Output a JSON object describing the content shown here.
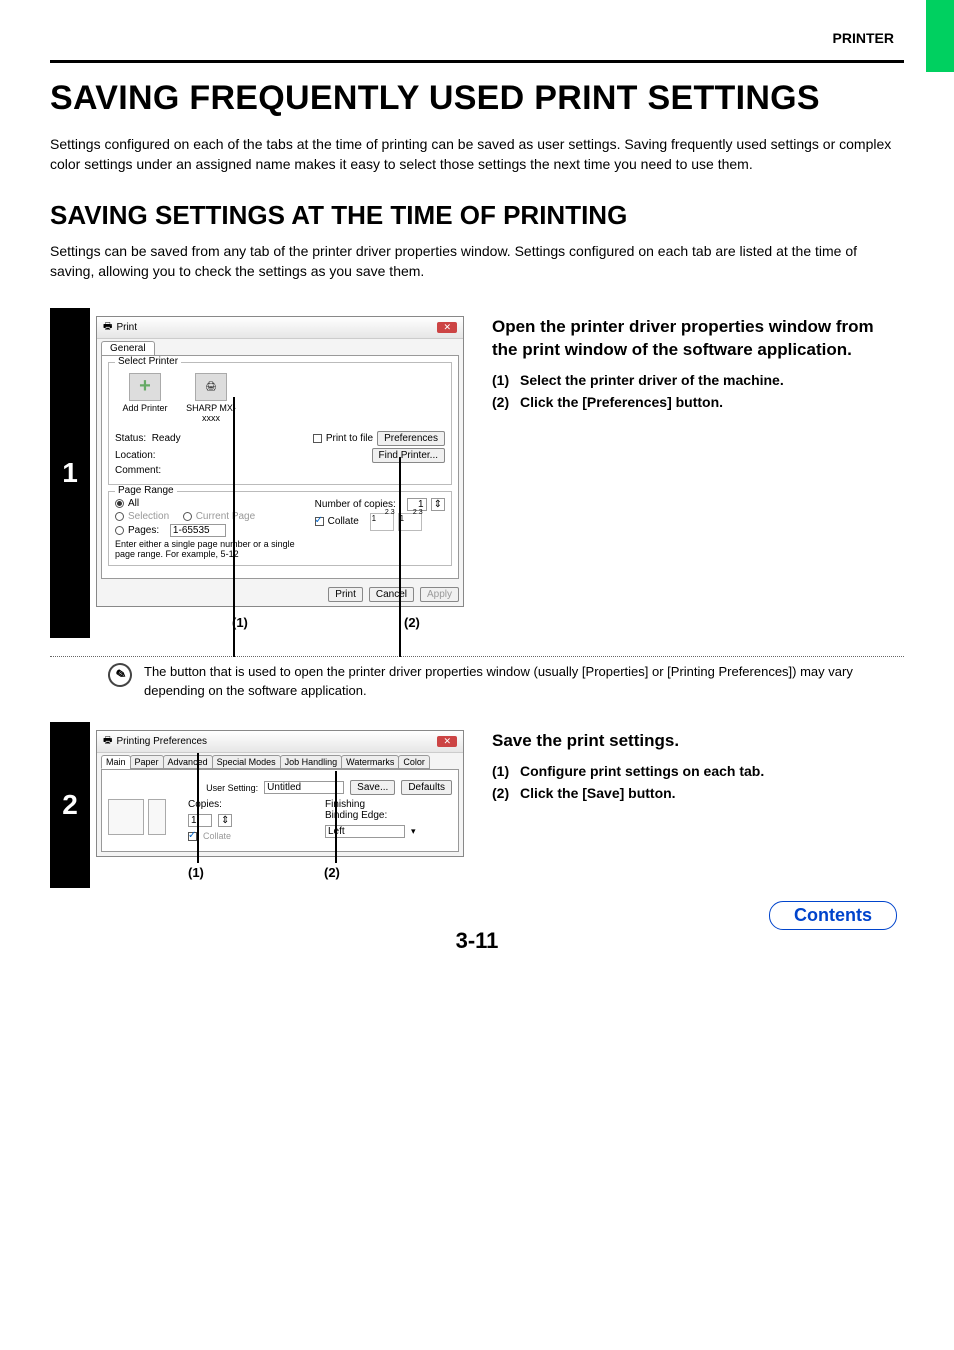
{
  "header": {
    "section": "PRINTER"
  },
  "title": "SAVING FREQUENTLY USED PRINT SETTINGS",
  "intro": "Settings configured on each of the tabs at the time of printing can be saved as user settings. Saving frequently used settings or complex color settings under an assigned name makes it easy to select those settings the next time you need to use them.",
  "subtitle": "SAVING SETTINGS AT THE TIME OF PRINTING",
  "intro2": "Settings can be saved from any tab of the printer driver properties window. Settings configured on each tab are listed at the time of saving, allowing you to check the settings as you save them.",
  "step1": {
    "num": "1",
    "instr_head": "Open the printer driver properties window from the print window of the software application.",
    "items": [
      {
        "n": "(1)",
        "t": "Select the printer driver of the machine."
      },
      {
        "n": "(2)",
        "t": "Click the [Preferences] button."
      }
    ],
    "dlg": {
      "title": "Print",
      "tab": "General",
      "select_printer_legend": "Select Printer",
      "printers": [
        {
          "name": "Add Printer",
          "plus": true
        },
        {
          "name": "SHARP MX-xxxx",
          "plus": false
        }
      ],
      "status_label": "Status:",
      "status_value": "Ready",
      "location_label": "Location:",
      "comment_label": "Comment:",
      "print_to_file": "Print to file",
      "prefs_btn": "Preferences",
      "find_btn": "Find Printer...",
      "page_range_legend": "Page Range",
      "all": "All",
      "selection": "Selection",
      "current_page": "Current Page",
      "pages": "Pages:",
      "pages_val": "1-65535",
      "pages_hint": "Enter either a single page number or a single page range.  For example, 5-12",
      "copies_label": "Number of copies:",
      "copies_val": "1",
      "collate": "Collate",
      "print_btn": "Print",
      "cancel_btn": "Cancel",
      "apply_btn": "Apply"
    },
    "ptr1": "(1)",
    "ptr2": "(2)"
  },
  "note": "The button that is used to open the printer driver properties window (usually [Properties] or [Printing Preferences]) may vary depending on the software application.",
  "step2": {
    "num": "2",
    "instr_head": "Save the print settings.",
    "items": [
      {
        "n": "(1)",
        "t": "Configure print settings on each tab."
      },
      {
        "n": "(2)",
        "t": "Click the [Save] button."
      }
    ],
    "dlg": {
      "title": "Printing Preferences",
      "tabs": [
        "Main",
        "Paper",
        "Advanced",
        "Special Modes",
        "Job Handling",
        "Watermarks",
        "Color"
      ],
      "user_setting_label": "User Setting:",
      "user_setting_val": "Untitled",
      "save_btn": "Save...",
      "defaults_btn": "Defaults",
      "copies_label": "Copies:",
      "copies_val": "1",
      "collate": "Collate",
      "finishing_label": "Finishing",
      "binding_label": "Binding Edge:",
      "binding_val": "Left"
    },
    "ptr1": "(1)",
    "ptr2": "(2)"
  },
  "page_num": "3-11",
  "contents": "Contents"
}
